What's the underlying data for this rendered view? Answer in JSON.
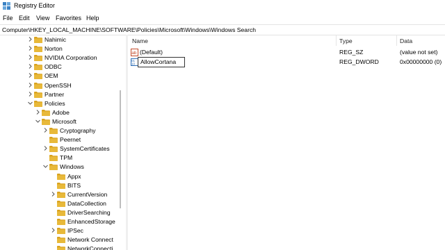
{
  "window": {
    "title": "Registry Editor"
  },
  "menu": [
    "File",
    "Edit",
    "View",
    "Favorites",
    "Help"
  ],
  "address": "Computer\\HKEY_LOCAL_MACHINE\\SOFTWARE\\Policies\\Microsoft\\Windows\\Windows Search",
  "tree": [
    {
      "label": "Nahimic",
      "expanded": false,
      "level": 0
    },
    {
      "label": "Norton",
      "expanded": false,
      "level": 0
    },
    {
      "label": "NVIDIA Corporation",
      "expanded": false,
      "level": 0
    },
    {
      "label": "ODBC",
      "expanded": false,
      "level": 0
    },
    {
      "label": "OEM",
      "expanded": false,
      "level": 0
    },
    {
      "label": "OpenSSH",
      "expanded": false,
      "level": 0
    },
    {
      "label": "Partner",
      "expanded": false,
      "level": 0
    },
    {
      "label": "Policies",
      "expanded": true,
      "level": 0
    },
    {
      "label": "Adobe",
      "expanded": false,
      "level": 1
    },
    {
      "label": "Microsoft",
      "expanded": true,
      "level": 1
    },
    {
      "label": "Cryptography",
      "expanded": false,
      "level": 2
    },
    {
      "label": "Peernet",
      "expanded": null,
      "level": 2
    },
    {
      "label": "SystemCertificates",
      "expanded": false,
      "level": 2
    },
    {
      "label": "TPM",
      "expanded": null,
      "level": 2
    },
    {
      "label": "Windows",
      "expanded": true,
      "level": 2
    },
    {
      "label": "Appx",
      "expanded": null,
      "level": 3
    },
    {
      "label": "BITS",
      "expanded": null,
      "level": 3
    },
    {
      "label": "CurrentVersion",
      "expanded": false,
      "level": 3
    },
    {
      "label": "DataCollection",
      "expanded": null,
      "level": 3
    },
    {
      "label": "DriverSearching",
      "expanded": null,
      "level": 3
    },
    {
      "label": "EnhancedStorage",
      "expanded": null,
      "level": 3
    },
    {
      "label": "IPSec",
      "expanded": false,
      "level": 3
    },
    {
      "label": "Network Connect",
      "expanded": null,
      "level": 3
    },
    {
      "label": "NetworkConnecti",
      "expanded": null,
      "level": 3
    }
  ],
  "columns": {
    "name": "Name",
    "type": "Type",
    "data": "Data"
  },
  "values": [
    {
      "name": "(Default)",
      "type": "REG_SZ",
      "data": "(value not set)",
      "icon": "string-value-icon"
    },
    {
      "name": "AllowCortana",
      "type": "REG_DWORD",
      "data": "0x00000000 (0)",
      "icon": "dword-value-icon",
      "renaming": true
    }
  ],
  "colors": {
    "folder": "#e8b93a",
    "folder_dark": "#d9a21e",
    "chevron": "#555555",
    "accent": "#0078d4"
  }
}
